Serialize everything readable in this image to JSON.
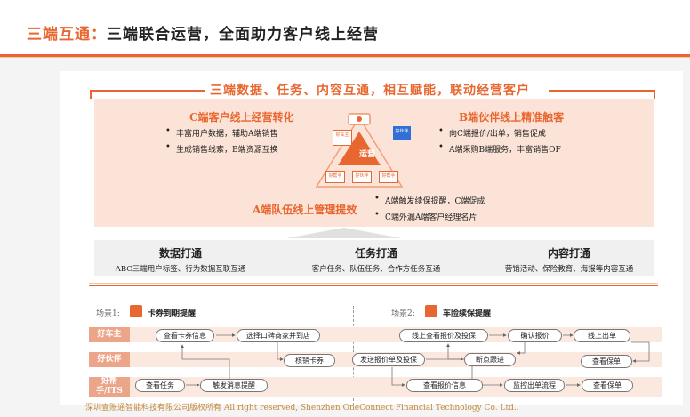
{
  "header": {
    "prefix": "三端互通：",
    "title": "三端联合运营，全面助力客户线上经营"
  },
  "banner": "三端数据、任务、内容互通，相互赋能，联动经营客户",
  "c_block": {
    "title": "C端客户线上经营转化",
    "items": [
      "丰富用户数据，辅助A端销售",
      "生成销售线索，B端资源互换"
    ]
  },
  "b_block": {
    "title": "B端伙伴线上精准触客",
    "items": [
      "向C端报价/出单，销售促成",
      "A端采购B端服务，丰富销售OF"
    ]
  },
  "a_block": {
    "title": "A端队伍线上管理提效",
    "items": [
      "A端触发续保提醒，C端促成",
      "C端外漏A端客户经理名片"
    ]
  },
  "center": {
    "core": "运营",
    "left_node": "好车主",
    "right_node": "好伙伴",
    "bottom_left": "好帮手",
    "bottom_mid": "好伙伴",
    "bottom_right": "好帮手"
  },
  "pillars": [
    {
      "title": "数据打通",
      "sub": "ABC三端用户标签、行为数据互联互通"
    },
    {
      "title": "任务打通",
      "sub": "客户任务、队伍任务、合作方任务互通"
    },
    {
      "title": "内容打通",
      "sub": "营销活动、保险教育、海报等内容互通"
    }
  ],
  "scene1": {
    "label": "场景1:",
    "title": "卡券到期提醒"
  },
  "scene2": {
    "label": "场景2:",
    "title": "车险续保提醒"
  },
  "roles": [
    "好车主",
    "好伙伴",
    "好帮手/ITS"
  ],
  "flow1": {
    "view_coupon": "查看卡券信息",
    "choose_shop": "选择口碑商家并到店",
    "redeem": "核销卡券",
    "view_task": "查看任务",
    "trigger_msg": "触发消息提醒"
  },
  "flow2": {
    "online_quote": "线上查看报价及投保",
    "confirm_quote": "确认报价",
    "online_order": "线上出单",
    "send_quote": "发送报价单及投保",
    "breakpoint": "断点跟进",
    "view_policy1": "查看保单",
    "view_quote": "查看报价信息",
    "monitor": "监控出单流程",
    "view_policy2": "查看保单"
  },
  "footer": "深圳壹账通智能科技有限公司版权所有  All right reserved, Shenzhen OneConnect Financial Technology Co. Ltd..",
  "colors": {
    "accent": "#e8662f",
    "peach": "#fbe3d7",
    "role": "#eda58a"
  }
}
